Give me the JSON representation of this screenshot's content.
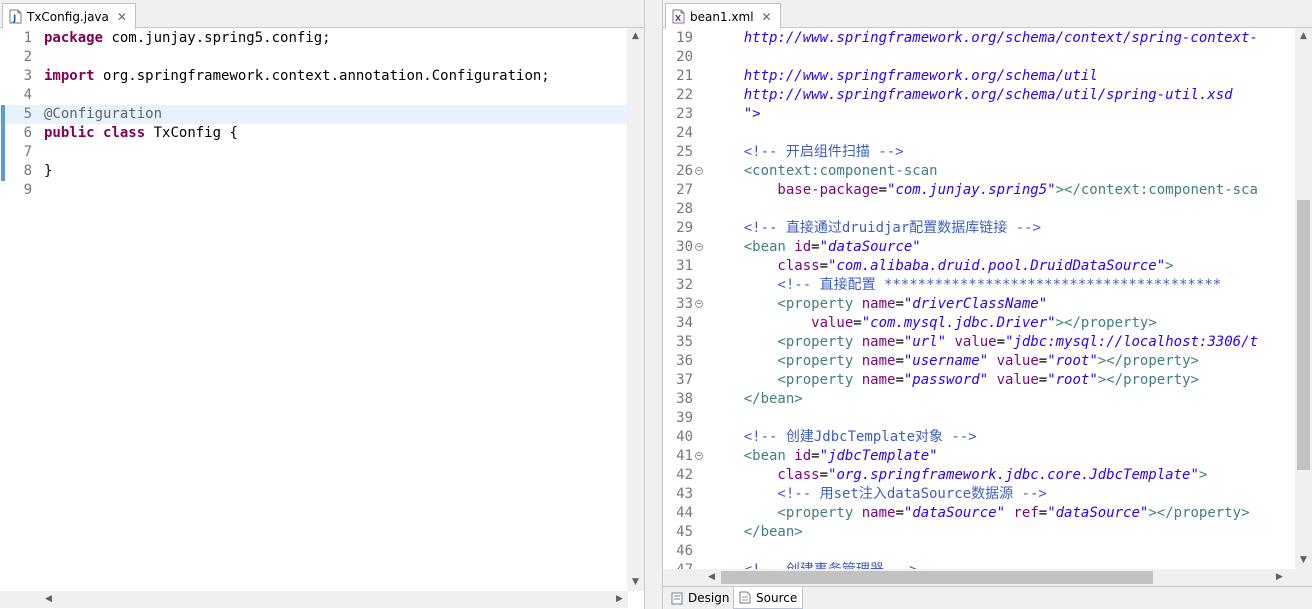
{
  "left_editor": {
    "tab": {
      "title": "TxConfig.java",
      "icon": "java-file-icon",
      "close": "✕"
    },
    "highlighted_line": 5,
    "lines": [
      {
        "n": "1",
        "parts": [
          [
            "kw",
            "package"
          ],
          [
            "",
            " com.junjay.spring5.config;"
          ]
        ]
      },
      {
        "n": "2",
        "parts": []
      },
      {
        "n": "3",
        "parts": [
          [
            "kw",
            "import"
          ],
          [
            "",
            " org.springframework.context.annotation.Configuration;"
          ]
        ]
      },
      {
        "n": "4",
        "parts": []
      },
      {
        "n": "5",
        "parts": [
          [
            "ann",
            "@Configuration"
          ]
        ]
      },
      {
        "n": "6",
        "parts": [
          [
            "kw",
            "public"
          ],
          [
            "",
            " "
          ],
          [
            "kw",
            "class"
          ],
          [
            "",
            " TxConfig {"
          ]
        ]
      },
      {
        "n": "7",
        "parts": []
      },
      {
        "n": "8",
        "parts": [
          [
            "",
            "}"
          ]
        ]
      },
      {
        "n": "9",
        "parts": []
      }
    ]
  },
  "right_editor": {
    "tab": {
      "title": "bean1.xml",
      "icon": "xml-file-icon",
      "close": "✕"
    },
    "lines": [
      {
        "n": "19",
        "fold": false,
        "parts": [
          [
            "url",
            "    http://www.springframework.org/schema/context/spring-context-"
          ]
        ]
      },
      {
        "n": "20",
        "fold": false,
        "parts": []
      },
      {
        "n": "21",
        "fold": false,
        "parts": [
          [
            "url",
            "    http://www.springframework.org/schema/util"
          ]
        ]
      },
      {
        "n": "22",
        "fold": false,
        "parts": [
          [
            "url",
            "    http://www.springframework.org/schema/util/spring-util.xsd"
          ]
        ]
      },
      {
        "n": "23",
        "fold": false,
        "parts": [
          [
            "val",
            "    \">"
          ]
        ]
      },
      {
        "n": "24",
        "fold": false,
        "parts": []
      },
      {
        "n": "25",
        "fold": false,
        "parts": [
          [
            "com",
            "    <!-- 开启组件扫描 -->"
          ]
        ]
      },
      {
        "n": "26",
        "fold": true,
        "parts": [
          [
            "tag",
            "    <context:component-scan"
          ]
        ]
      },
      {
        "n": "27",
        "fold": false,
        "parts": [
          [
            "attr",
            "        base-package"
          ],
          [
            "",
            "="
          ],
          [
            "val",
            "\"com.junjay.spring5\""
          ],
          [
            "tag",
            "></context:component-sca"
          ]
        ]
      },
      {
        "n": "28",
        "fold": false,
        "parts": []
      },
      {
        "n": "29",
        "fold": false,
        "parts": [
          [
            "com",
            "    <!-- 直接通过druidjar配置数据库链接 -->"
          ]
        ]
      },
      {
        "n": "30",
        "fold": true,
        "parts": [
          [
            "tag",
            "    <bean "
          ],
          [
            "attr",
            "id"
          ],
          [
            "",
            "="
          ],
          [
            "val",
            "\"dataSource\""
          ]
        ]
      },
      {
        "n": "31",
        "fold": false,
        "parts": [
          [
            "attr",
            "        class"
          ],
          [
            "",
            "="
          ],
          [
            "val",
            "\"com.alibaba.druid.pool.DruidDataSource\""
          ],
          [
            "tag",
            ">"
          ]
        ]
      },
      {
        "n": "32",
        "fold": false,
        "parts": [
          [
            "com",
            "        <!-- 直接配置 ****************************************"
          ]
        ]
      },
      {
        "n": "33",
        "fold": true,
        "parts": [
          [
            "tag",
            "        <property "
          ],
          [
            "attr",
            "name"
          ],
          [
            "",
            "="
          ],
          [
            "val",
            "\"driverClassName\""
          ]
        ]
      },
      {
        "n": "34",
        "fold": false,
        "parts": [
          [
            "attr",
            "            value"
          ],
          [
            "",
            "="
          ],
          [
            "val",
            "\"com.mysql.jdbc.Driver\""
          ],
          [
            "tag",
            "></property>"
          ]
        ]
      },
      {
        "n": "35",
        "fold": false,
        "parts": [
          [
            "tag",
            "        <property "
          ],
          [
            "attr",
            "name"
          ],
          [
            "",
            "="
          ],
          [
            "val",
            "\"url\""
          ],
          [
            "",
            " "
          ],
          [
            "attr",
            "value"
          ],
          [
            "",
            "="
          ],
          [
            "val",
            "\"jdbc:mysql://localhost:3306/t"
          ]
        ]
      },
      {
        "n": "36",
        "fold": false,
        "parts": [
          [
            "tag",
            "        <property "
          ],
          [
            "attr",
            "name"
          ],
          [
            "",
            "="
          ],
          [
            "val",
            "\"username\""
          ],
          [
            "",
            " "
          ],
          [
            "attr",
            "value"
          ],
          [
            "",
            "="
          ],
          [
            "val",
            "\"root\""
          ],
          [
            "tag",
            "></property>"
          ]
        ]
      },
      {
        "n": "37",
        "fold": false,
        "parts": [
          [
            "tag",
            "        <property "
          ],
          [
            "attr",
            "name"
          ],
          [
            "",
            "="
          ],
          [
            "val",
            "\"password\""
          ],
          [
            "",
            " "
          ],
          [
            "attr",
            "value"
          ],
          [
            "",
            "="
          ],
          [
            "val",
            "\"root\""
          ],
          [
            "tag",
            "></property>"
          ]
        ]
      },
      {
        "n": "38",
        "fold": false,
        "parts": [
          [
            "tag",
            "    </bean>"
          ]
        ]
      },
      {
        "n": "39",
        "fold": false,
        "parts": []
      },
      {
        "n": "40",
        "fold": false,
        "parts": [
          [
            "com",
            "    <!-- 创建JdbcTemplate对象 -->"
          ]
        ]
      },
      {
        "n": "41",
        "fold": true,
        "parts": [
          [
            "tag",
            "    <bean "
          ],
          [
            "attr",
            "id"
          ],
          [
            "",
            "="
          ],
          [
            "val",
            "\"jdbcTemplate\""
          ]
        ]
      },
      {
        "n": "42",
        "fold": false,
        "parts": [
          [
            "attr",
            "        class"
          ],
          [
            "",
            "="
          ],
          [
            "val",
            "\"org.springframework.jdbc.core.JdbcTemplate\""
          ],
          [
            "tag",
            ">"
          ]
        ]
      },
      {
        "n": "43",
        "fold": false,
        "parts": [
          [
            "com",
            "        <!-- 用set注入dataSource数据源 -->"
          ]
        ]
      },
      {
        "n": "44",
        "fold": false,
        "parts": [
          [
            "tag",
            "        <property "
          ],
          [
            "attr",
            "name"
          ],
          [
            "",
            "="
          ],
          [
            "val",
            "\"dataSource\""
          ],
          [
            "",
            " "
          ],
          [
            "attr",
            "ref"
          ],
          [
            "",
            "="
          ],
          [
            "val",
            "\"dataSource\""
          ],
          [
            "tag",
            "></property>"
          ]
        ]
      },
      {
        "n": "45",
        "fold": false,
        "parts": [
          [
            "tag",
            "    </bean>"
          ]
        ]
      },
      {
        "n": "46",
        "fold": false,
        "parts": []
      },
      {
        "n": "47",
        "fold": false,
        "parts": [
          [
            "com",
            "    <!-- 创建事务管理器 -->"
          ]
        ]
      }
    ],
    "bottom_tabs": [
      {
        "label": "Design",
        "icon": "design-icon",
        "active": false
      },
      {
        "label": "Source",
        "icon": "source-icon",
        "active": true
      }
    ]
  },
  "colors": {
    "keyword": "#7f0055",
    "annotation": "#646464",
    "xml_tag": "#3f7f7f",
    "xml_attr": "#7f007f",
    "string": "#2a00ff",
    "comment": "#3f5fbf",
    "highlight": "#e8f2fe"
  }
}
